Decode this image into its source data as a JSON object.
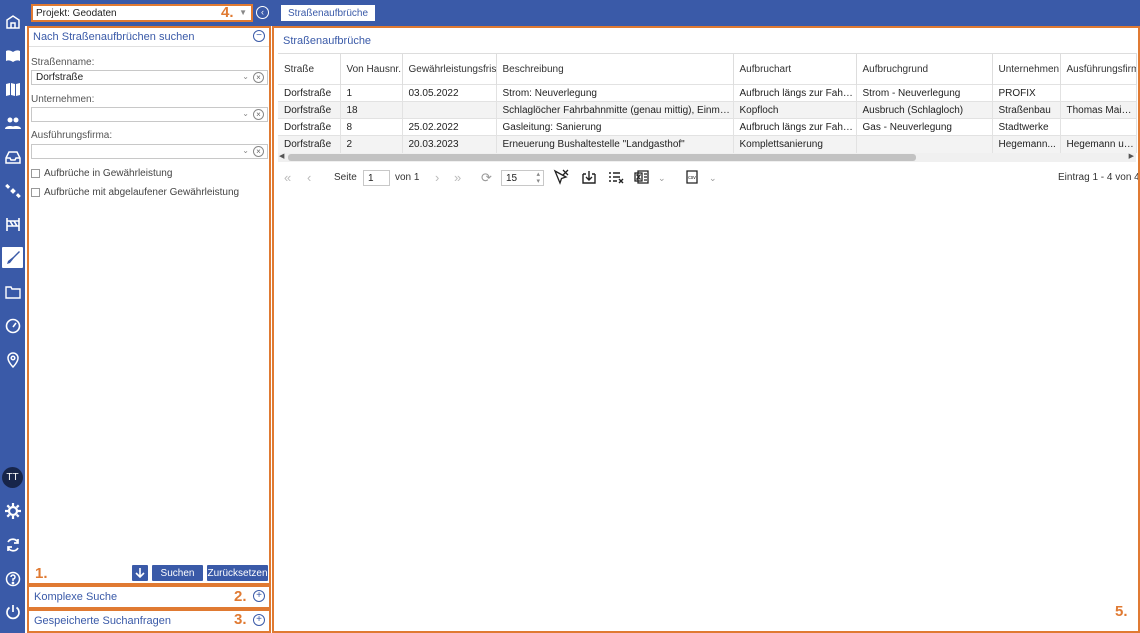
{
  "project": {
    "label": "Projekt: Geodaten"
  },
  "tab": {
    "label": "Straßenaufbrüche"
  },
  "annotations": {
    "a1": "1.",
    "a2": "2.",
    "a3": "3.",
    "a4": "4.",
    "a5": "5."
  },
  "avatar": {
    "initials": "TT"
  },
  "search_panel": {
    "title": "Nach Straßenaufbrüchen suchen",
    "street_label": "Straßenname:",
    "street_value": "Dorfstraße",
    "company_label": "Unternehmen:",
    "company_value": "",
    "firm_label": "Ausführungsfirma:",
    "firm_value": "",
    "check1": "Aufbrüche in Gewährleistung",
    "check2": "Aufbrüche mit abgelaufener Gewährleistung",
    "search_btn": "Suchen",
    "reset_btn": "Zurücksetzen"
  },
  "complex_search": {
    "title": "Komplexe Suche"
  },
  "saved_search": {
    "title": "Gespeicherte Suchanfragen"
  },
  "results": {
    "title": "Straßenaufbrüche",
    "columns": [
      "Straße",
      "Von Hausnr.",
      "Gewährleistungsfrist",
      "Beschreibung",
      "Aufbruchart",
      "Aufbruchgrund",
      "Unternehmen",
      "Ausführungsfirma"
    ],
    "rows": [
      [
        "Dorfstraße",
        "1",
        "03.05.2022",
        "Strom: Neuverlegung",
        "Aufbruch längs zur Fahrb...",
        "Strom - Neuverlegung",
        "PROFIX",
        ""
      ],
      [
        "Dorfstraße",
        "18",
        "",
        "Schlaglöcher Fahrbahnmitte (genau mittig), Einmündu...",
        "Kopfloch",
        "Ausbruch (Schlagloch)",
        "Straßenbau",
        "Thomas Maier ..."
      ],
      [
        "Dorfstraße",
        "8",
        "25.02.2022",
        "Gasleitung: Sanierung",
        "Aufbruch längs zur Fahrb...",
        "Gas - Neuverlegung",
        "Stadtwerke",
        ""
      ],
      [
        "Dorfstraße",
        "2",
        "20.03.2023",
        "Erneuerung Bushaltestelle \"Landgasthof\"",
        "Komplettsanierung",
        "",
        "Hegemann...",
        "Hegemann und..."
      ]
    ]
  },
  "pager": {
    "page_label": "Seite",
    "page_value": "1",
    "of_label": "von 1",
    "size_value": "15",
    "summary": "Eintrag 1 - 4 von 4"
  },
  "icons": [
    "home-icon",
    "book-icon",
    "map-icon",
    "users-icon",
    "inbox-icon",
    "satellite-icon",
    "barrier-icon",
    "shovel-icon",
    "folder-icon",
    "gauge-icon",
    "location-icon",
    "gear-icon",
    "refresh-icon",
    "help-icon",
    "power-icon"
  ]
}
